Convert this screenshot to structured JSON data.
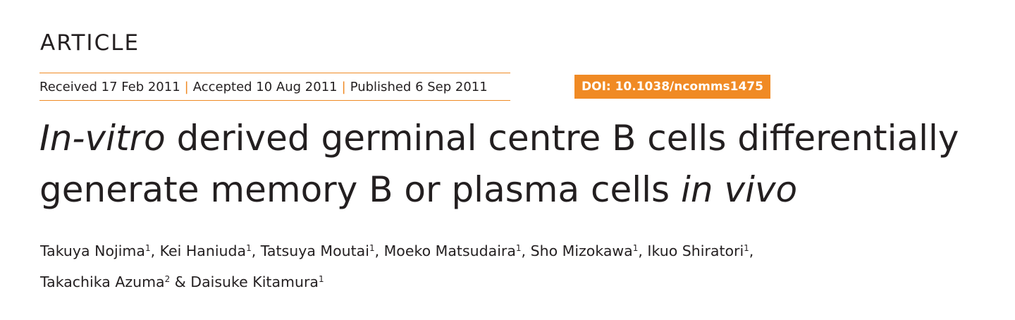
{
  "header": {
    "article_type": "ARTICLE",
    "received": "Received 17 Feb 2011",
    "accepted": "Accepted 10 Aug 2011",
    "published": "Published 6 Sep 2011",
    "separator": "|",
    "doi": "DOI: 10.1038/ncomms1475"
  },
  "title": {
    "italic_start": "In-vitro",
    "middle": " derived germinal centre B cells differentially generate memory B or plasma cells ",
    "italic_end": "in vivo"
  },
  "authors": [
    {
      "name": "Takuya Nojima",
      "affil": "1",
      "after": ", "
    },
    {
      "name": "Kei Haniuda",
      "affil": "1",
      "after": ", "
    },
    {
      "name": "Tatsuya Moutai",
      "affil": "1",
      "after": ", "
    },
    {
      "name": "Moeko Matsudaira",
      "affil": "1",
      "after": ", "
    },
    {
      "name": "Sho Mizokawa",
      "affil": "1",
      "after": ", "
    },
    {
      "name": "Ikuo Shiratori",
      "affil": "1",
      "after": ", "
    },
    {
      "name": "Takachika Azuma",
      "affil": "2",
      "after": " & "
    },
    {
      "name": "Daisuke Kitamura",
      "affil": "1",
      "after": ""
    }
  ]
}
